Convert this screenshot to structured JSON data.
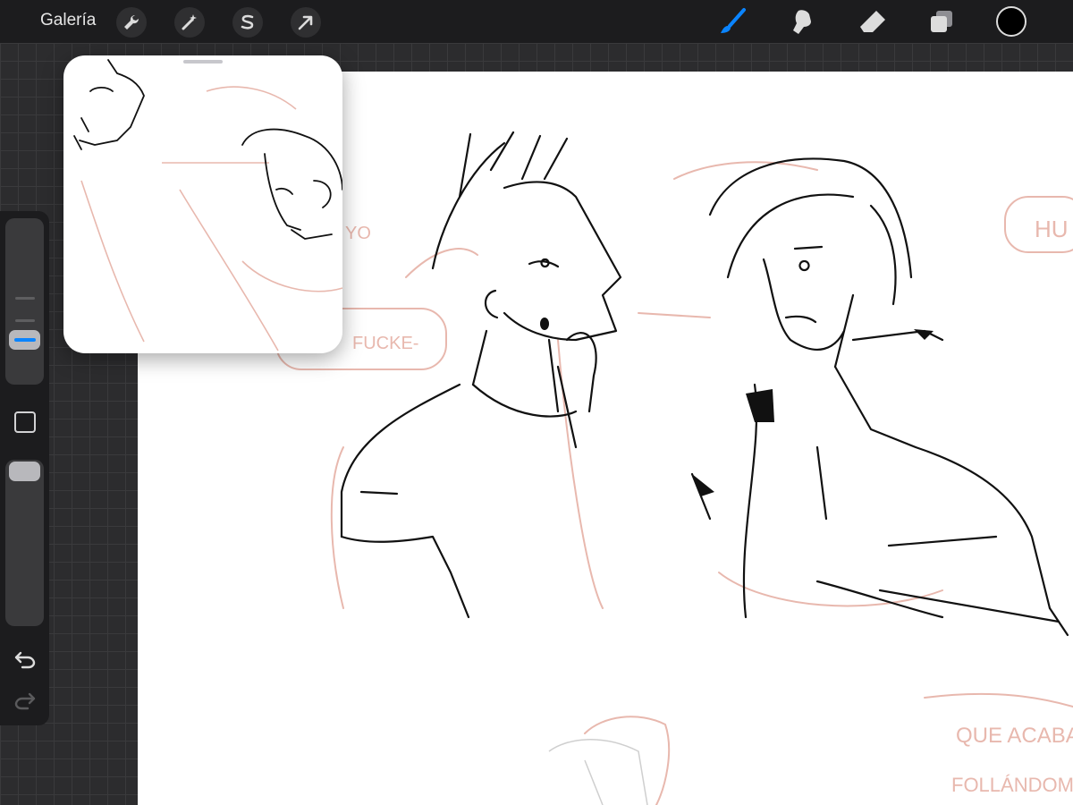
{
  "topbar": {
    "gallery_label": "Galería",
    "left_tools": [
      {
        "name": "actions",
        "icon": "wrench-icon"
      },
      {
        "name": "adjustments",
        "icon": "magic-wand-icon"
      },
      {
        "name": "selection",
        "icon": "selection-s-icon"
      },
      {
        "name": "transform",
        "icon": "arrow-cursor-icon"
      }
    ],
    "right_tools": [
      {
        "name": "brush",
        "icon": "brush-icon",
        "active": true
      },
      {
        "name": "smudge",
        "icon": "smudge-finger-icon"
      },
      {
        "name": "eraser",
        "icon": "eraser-icon"
      },
      {
        "name": "layers",
        "icon": "layers-icon"
      }
    ],
    "current_color": "#000000",
    "active_color": "#0a84ff"
  },
  "sidebar": {
    "brush_size_level": 0.12,
    "brush_opacity_level": 1.0,
    "undo_icon": "undo-arrow-icon",
    "redo_icon": "redo-arrow-icon"
  },
  "canvas": {
    "sketch_lettering": [
      "YO",
      "FUCKE-",
      "HU",
      "QUE ACABA",
      "FOLLÁNDOME"
    ],
    "sketch_color": "#e8b8ae",
    "ink_color": "#111111"
  },
  "reference_window": {
    "handle_icon": "drag-handle-icon"
  }
}
